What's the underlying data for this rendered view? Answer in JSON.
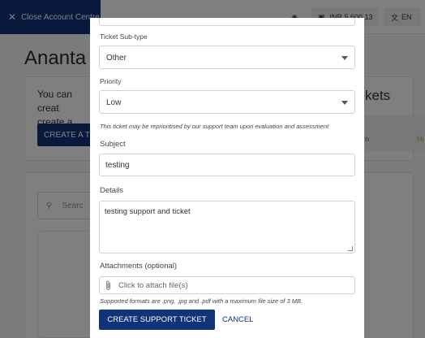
{
  "topbar": {
    "close_label": "Close Account Centre",
    "balance_text": "INR 5,600.13",
    "language": "EN"
  },
  "background": {
    "page_title": "Ananta C",
    "info_text_line1": "You can creat",
    "info_text_line2": "create a ticke",
    "create_button": "CREATE A TIC",
    "side_heading": "kets",
    "side_chip1": "n",
    "side_chip2": "Hi",
    "search_placeholder": "Searc"
  },
  "modal": {
    "sub_type": {
      "label": "Ticket Sub-type",
      "value": "Other"
    },
    "priority": {
      "label": "Priority",
      "value": "Low",
      "note": "This ticket may be reprioritised by our support team upon evaluation and assessment"
    },
    "subject": {
      "label": "Subject",
      "value": "testing"
    },
    "details": {
      "label": "Details",
      "value": "testing support and ticket"
    },
    "attachments": {
      "label": "Attachments (optional)",
      "placeholder": "Click to attach file(s)",
      "note": "Supported formats are .png, .jpg and .pdf with a maximum file size of 3 MB."
    },
    "submit_label": "CREATE SUPPORT TICKET",
    "cancel_label": "CANCEL"
  },
  "colors": {
    "primary": "#11337a",
    "overlay": "rgba(0,0,0,0.5)"
  }
}
